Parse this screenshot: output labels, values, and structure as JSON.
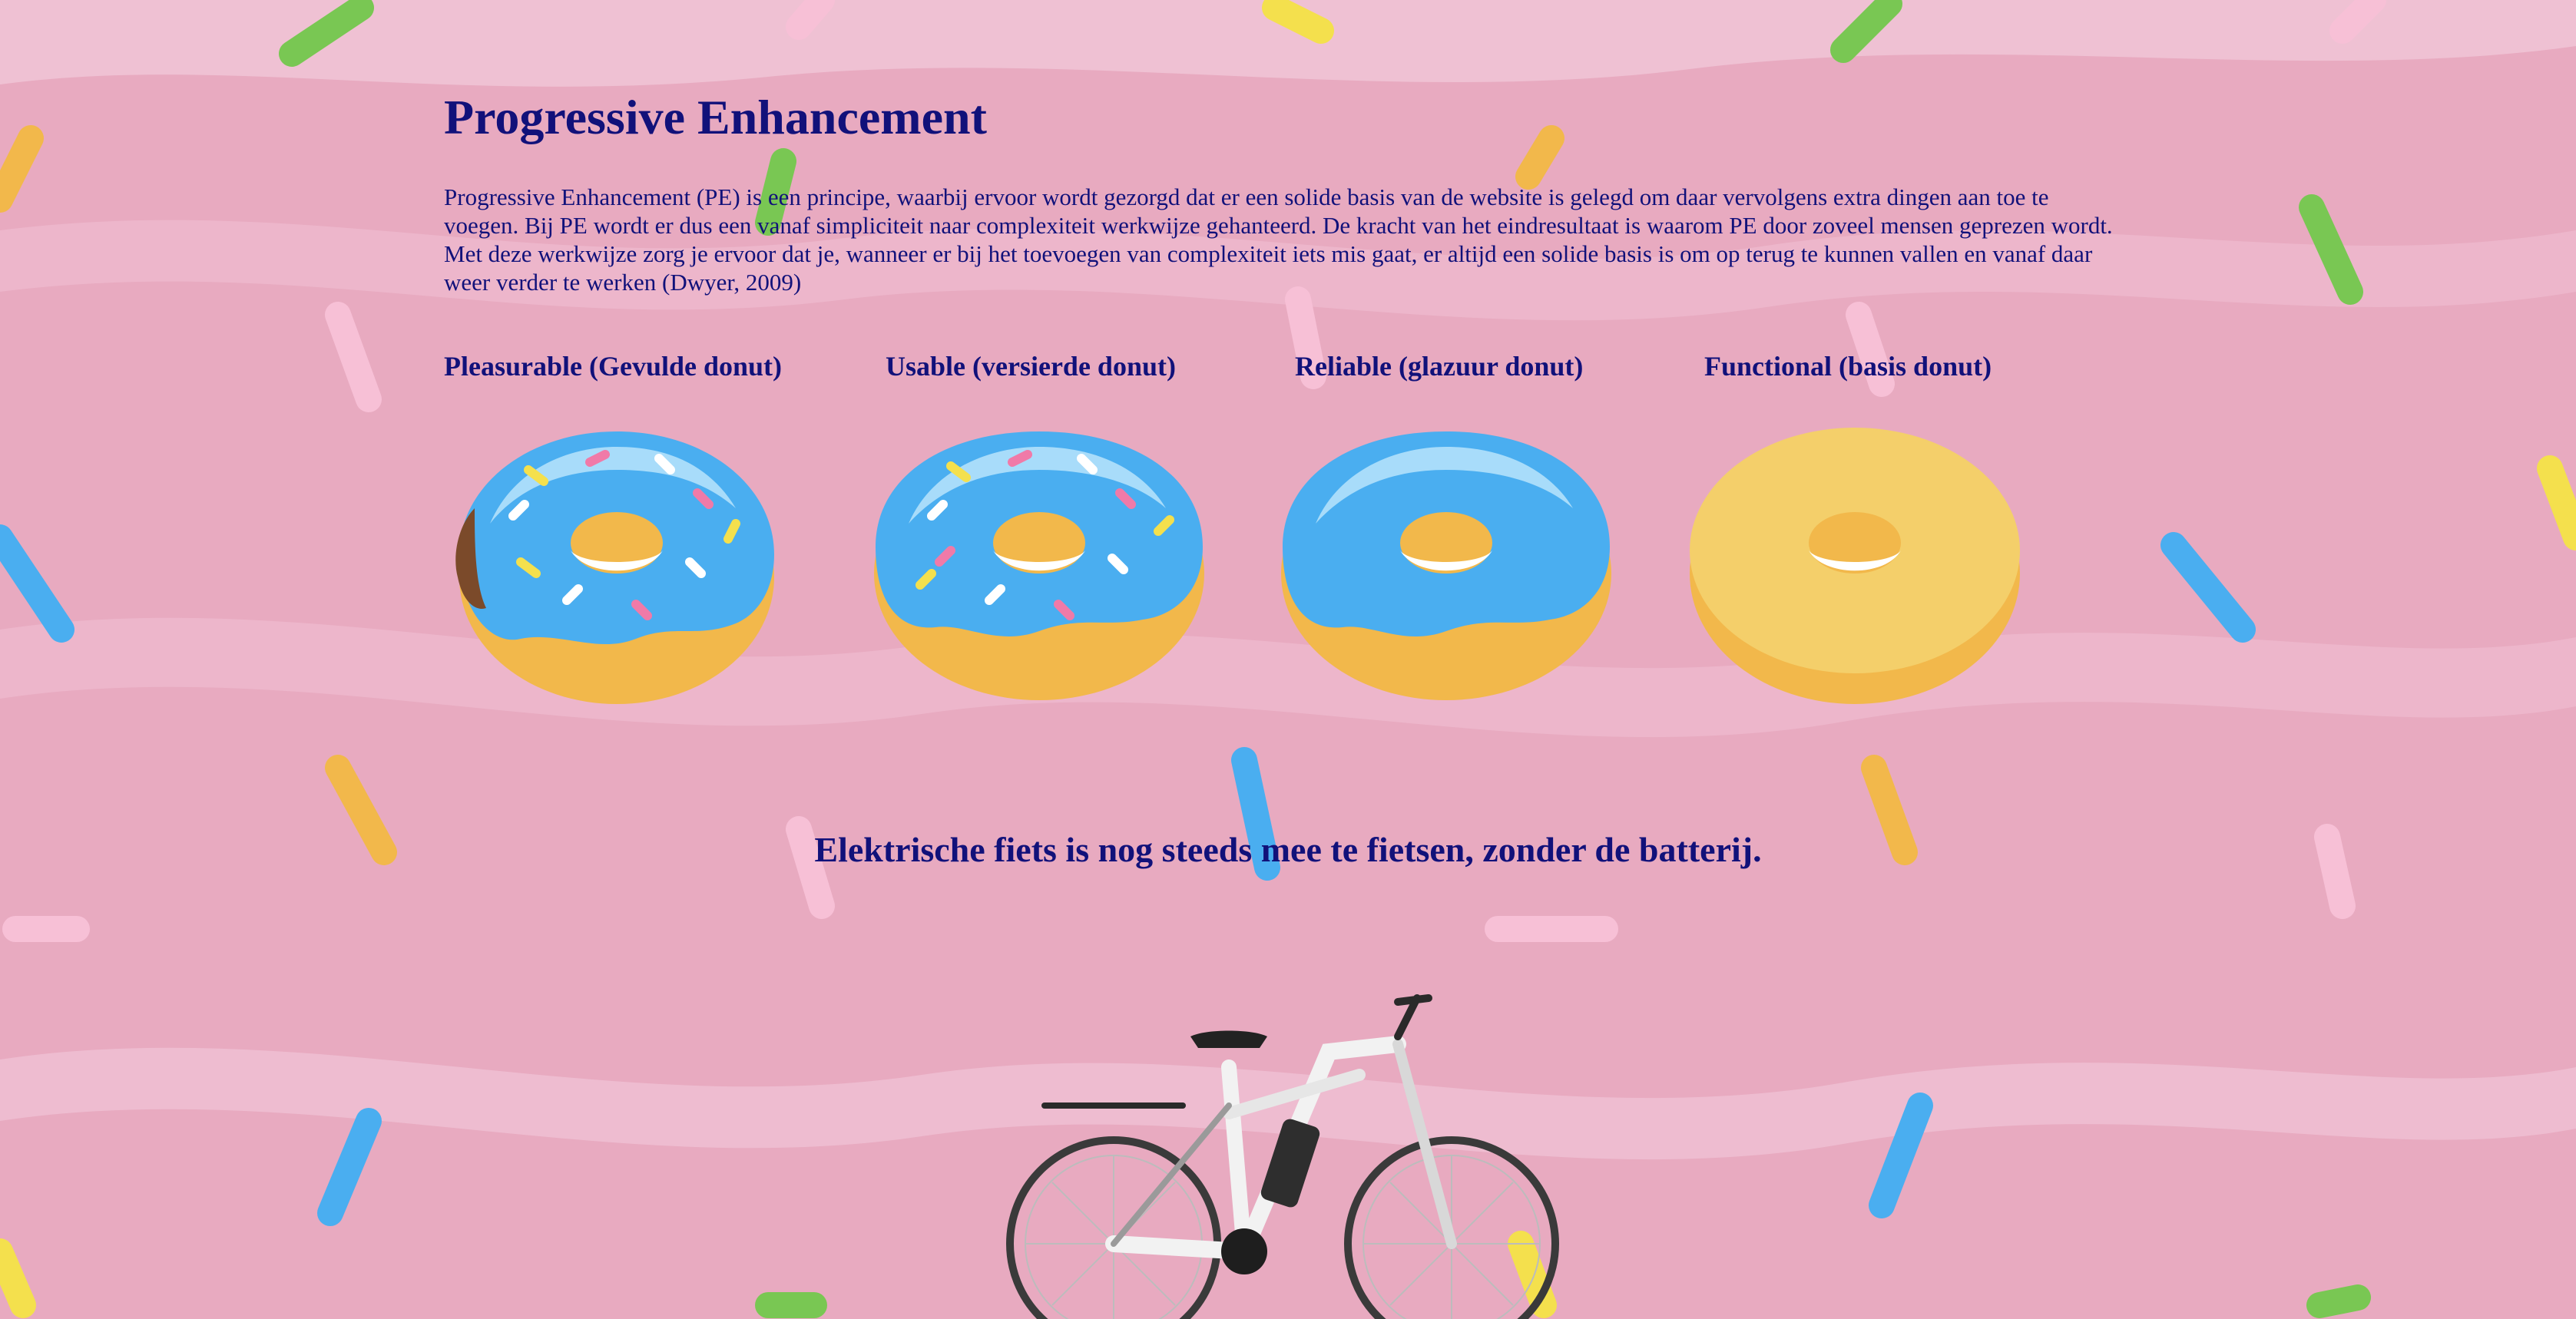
{
  "page": {
    "title": "Progressive Enhancement",
    "intro": "Progressive Enhancement (PE) is een principe, waarbij ervoor wordt gezorgd dat er een solide basis van de website is gelegd om daar vervolgens extra dingen aan toe te voegen. Bij PE wordt er dus een vanaf simpliciteit naar complexiteit werkwijze gehanteerd. De kracht van het eindresultaat is waarom PE door zoveel mensen geprezen wordt. Met deze werkwijze zorg je ervoor dat je, wanneer er bij het toevoegen van complexiteit iets mis gaat, er altijd een solide basis is om op terug te kunnen vallen en vanaf daar weer verder te werken (Dwyer, 2009)"
  },
  "donuts": [
    {
      "label": "Pleasurable (Gevulde donut)",
      "image": "filled-donut-image"
    },
    {
      "label": "Usable (versierde donut)",
      "image": "sprinkled-donut-image"
    },
    {
      "label": "Reliable (glazuur donut)",
      "image": "glazed-donut-image"
    },
    {
      "label": "Functional (basis donut)",
      "image": "plain-donut-image"
    }
  ],
  "bike": {
    "heading": "Elektrische fiets is nog steeds mee te fietsen, zonder de batterij.",
    "image": "electric-bike-image"
  },
  "colors": {
    "text": "#11117a",
    "background": "#e8aac0",
    "icing": "#4aaef0",
    "dough": "#f2b84b"
  }
}
